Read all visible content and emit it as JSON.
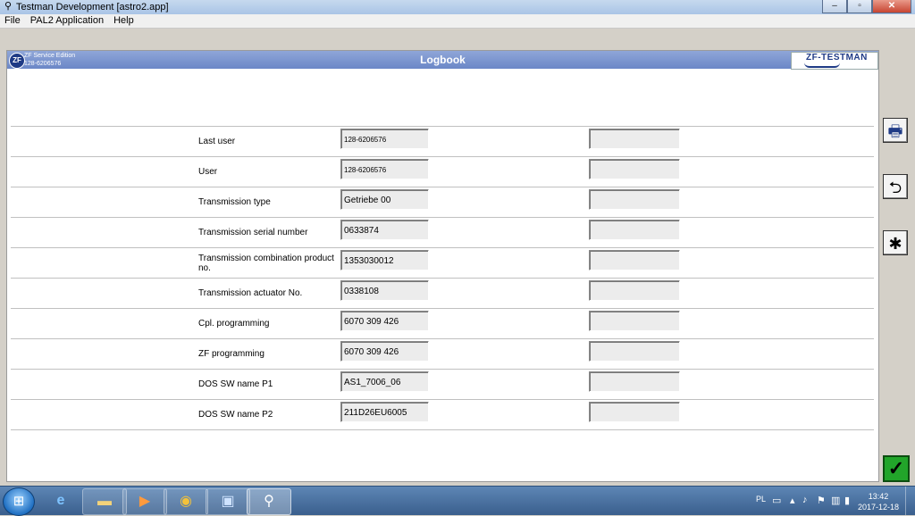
{
  "window": {
    "title": "Testman Development [astro2.app]",
    "minimize": "–",
    "maximize": "▫",
    "close": "✕"
  },
  "menu": [
    "File",
    "PAL2 Application",
    "Help"
  ],
  "header": {
    "logo_text": "ZF",
    "edition_line1": "ZF Service Edition",
    "edition_line2": "128-6206576",
    "page_title": "Logbook",
    "brand": "ZF-TESTMAN"
  },
  "rows": [
    {
      "label": "Last user",
      "value": "128-6206576"
    },
    {
      "label": "User",
      "value": "128-6206576"
    },
    {
      "label": "Transmission type",
      "value": "Getriebe  00"
    },
    {
      "label": "Transmission serial number",
      "value": "0633874"
    },
    {
      "label": "Transmission combination product no.",
      "value": "1353030012"
    },
    {
      "label": "Transmission actuator No.",
      "value": "0338108"
    },
    {
      "label": "Cpl. programming",
      "value": "6070 309 426"
    },
    {
      "label": "ZF programming",
      "value": "6070 309 426"
    },
    {
      "label": "DOS SW name P1",
      "value": "AS1_7006_06"
    },
    {
      "label": "DOS SW name P2",
      "value": "211D26EU6005"
    }
  ],
  "side_buttons": {
    "print_icon": "printer-icon",
    "back_icon": "return-icon",
    "star_icon": "asterisk-icon",
    "ok_icon": "checkmark-icon"
  },
  "taskbar": {
    "lang": "PL",
    "time": "13:42",
    "date": "2017-12-18"
  }
}
